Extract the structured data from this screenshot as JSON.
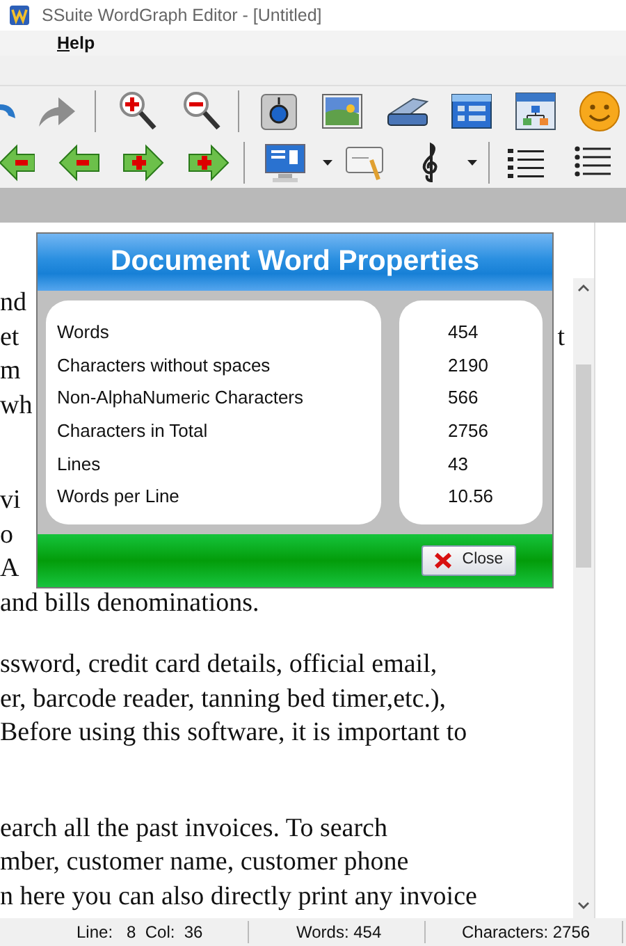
{
  "window": {
    "title": "SSuite WordGraph Editor - [Untitled]"
  },
  "menu": [
    {
      "label": "Help",
      "mnemonic": true
    }
  ],
  "document": {
    "paragraphs": [
      {
        "kind": "text",
        "lines": [
          {
            "left": "nd"
          },
          {
            "left": "et",
            "right": "t"
          },
          {
            "left": "m"
          },
          {
            "left": "wh"
          }
        ]
      },
      {
        "kind": "gap"
      },
      {
        "kind": "text",
        "lines": [
          {
            "left": "vi"
          },
          {
            "left": "o"
          },
          {
            "left": "A"
          },
          {
            "left": "and bills denominations."
          }
        ]
      },
      {
        "kind": "text",
        "lines": [
          {
            "left": "ssword, credit card details, official email,"
          },
          {
            "left": "er, barcode reader, tanning bed timer,etc.),"
          },
          {
            "left": "Before using this software, it is important to"
          }
        ]
      },
      {
        "kind": "gap"
      },
      {
        "kind": "text",
        "lines": [
          {
            "left": "earch all the past invoices. To search"
          },
          {
            "left": "mber, customer name, customer phone"
          },
          {
            "left": "n here you can also directly print any invoice"
          }
        ]
      }
    ]
  },
  "dialog": {
    "title": "Document Word Properties",
    "rows": [
      {
        "label": "Words",
        "value": "454"
      },
      {
        "label": "Characters without spaces",
        "value": "2190"
      },
      {
        "label": "Non-AlphaNumeric Characters",
        "value": "566"
      },
      {
        "label": "Characters in Total",
        "value": "2756"
      },
      {
        "label": "Lines",
        "value": "43"
      },
      {
        "label": "Words per Line",
        "value": "10.56"
      }
    ],
    "close_button": "Close"
  },
  "status_bar": [
    {
      "text": "Line:   8  Col:  36"
    },
    {
      "text": "Words: 454"
    },
    {
      "text": "Characters: 2756"
    }
  ]
}
